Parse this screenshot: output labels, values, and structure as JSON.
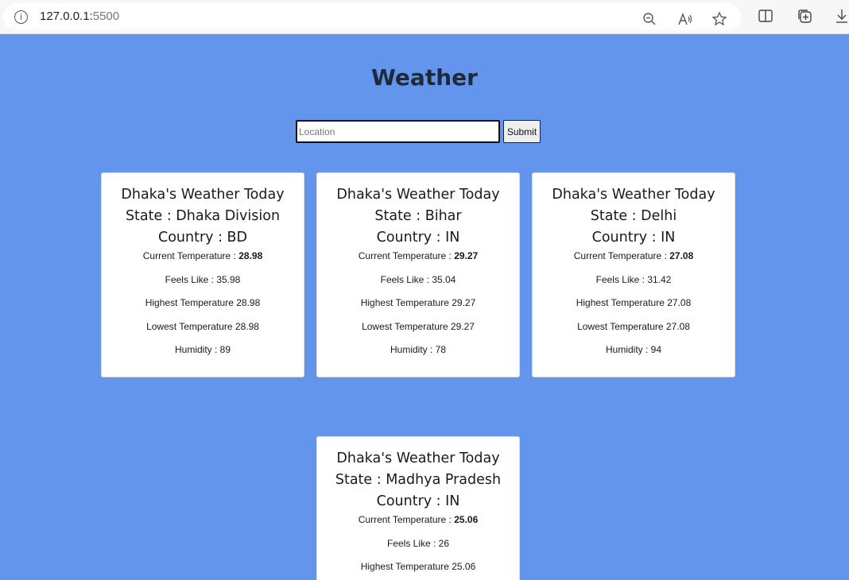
{
  "browser": {
    "url_host": "127.0.0.1:",
    "url_port": "5500"
  },
  "page": {
    "title": "Weather",
    "search": {
      "placeholder": "Location",
      "value": ""
    },
    "submit_label": "Submit"
  },
  "cards": [
    {
      "heading": "Dhaka's Weather Today",
      "state": "State : Dhaka Division",
      "country": "Country : BD",
      "current_label": "Current Temperature : ",
      "current_value": "28.98",
      "feels_like": "Feels Like : 35.98",
      "highest": "Highest Temperature 28.98",
      "lowest": "Lowest Temperature 28.98",
      "humidity": "Humidity : 89"
    },
    {
      "heading": "Dhaka's Weather Today",
      "state": "State : Bihar",
      "country": "Country : IN",
      "current_label": "Current Temperature : ",
      "current_value": "29.27",
      "feels_like": "Feels Like : 35.04",
      "highest": "Highest Temperature 29.27",
      "lowest": "Lowest Temperature 29.27",
      "humidity": "Humidity : 78"
    },
    {
      "heading": "Dhaka's Weather Today",
      "state": "State : Delhi",
      "country": "Country : IN",
      "current_label": "Current Temperature : ",
      "current_value": "27.08",
      "feels_like": "Feels Like : 31.42",
      "highest": "Highest Temperature 27.08",
      "lowest": "Lowest Temperature 27.08",
      "humidity": "Humidity : 94"
    },
    {
      "heading": "Dhaka's Weather Today",
      "state": "State : Madhya Pradesh",
      "country": "Country : IN",
      "current_label": "Current Temperature : ",
      "current_value": "25.06",
      "feels_like": "Feels Like : 26",
      "highest": "Highest Temperature 25.06"
    }
  ]
}
